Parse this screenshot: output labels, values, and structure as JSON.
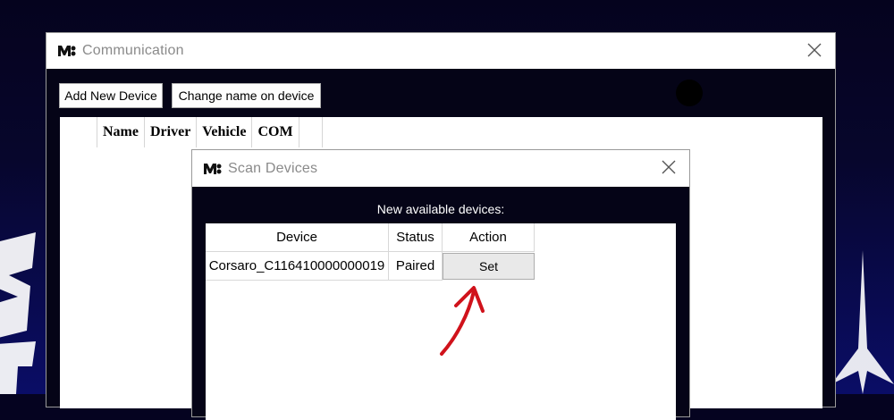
{
  "communication_window": {
    "title": "Communication",
    "buttons": {
      "add_new_device": "Add New Device",
      "change_name": "Change name on device"
    },
    "columns": [
      "Name",
      "Driver",
      "Vehicle",
      "COM"
    ]
  },
  "scan_window": {
    "title": "Scan Devices",
    "available_label": "New available devices:",
    "columns": {
      "device": "Device",
      "status": "Status",
      "action": "Action"
    },
    "rows": [
      {
        "device": "Corsaro_C116410000000019",
        "status": "Paired",
        "action": "Set"
      }
    ]
  },
  "icons": [
    "app-logo-icon",
    "close-icon"
  ],
  "colors": {
    "window_bg": "#050417",
    "titlebar_bg": "#ffffff",
    "title_text": "#8a8a8a",
    "annotation_arrow": "#d0121b",
    "desktop_glow": "#1a22c8"
  }
}
